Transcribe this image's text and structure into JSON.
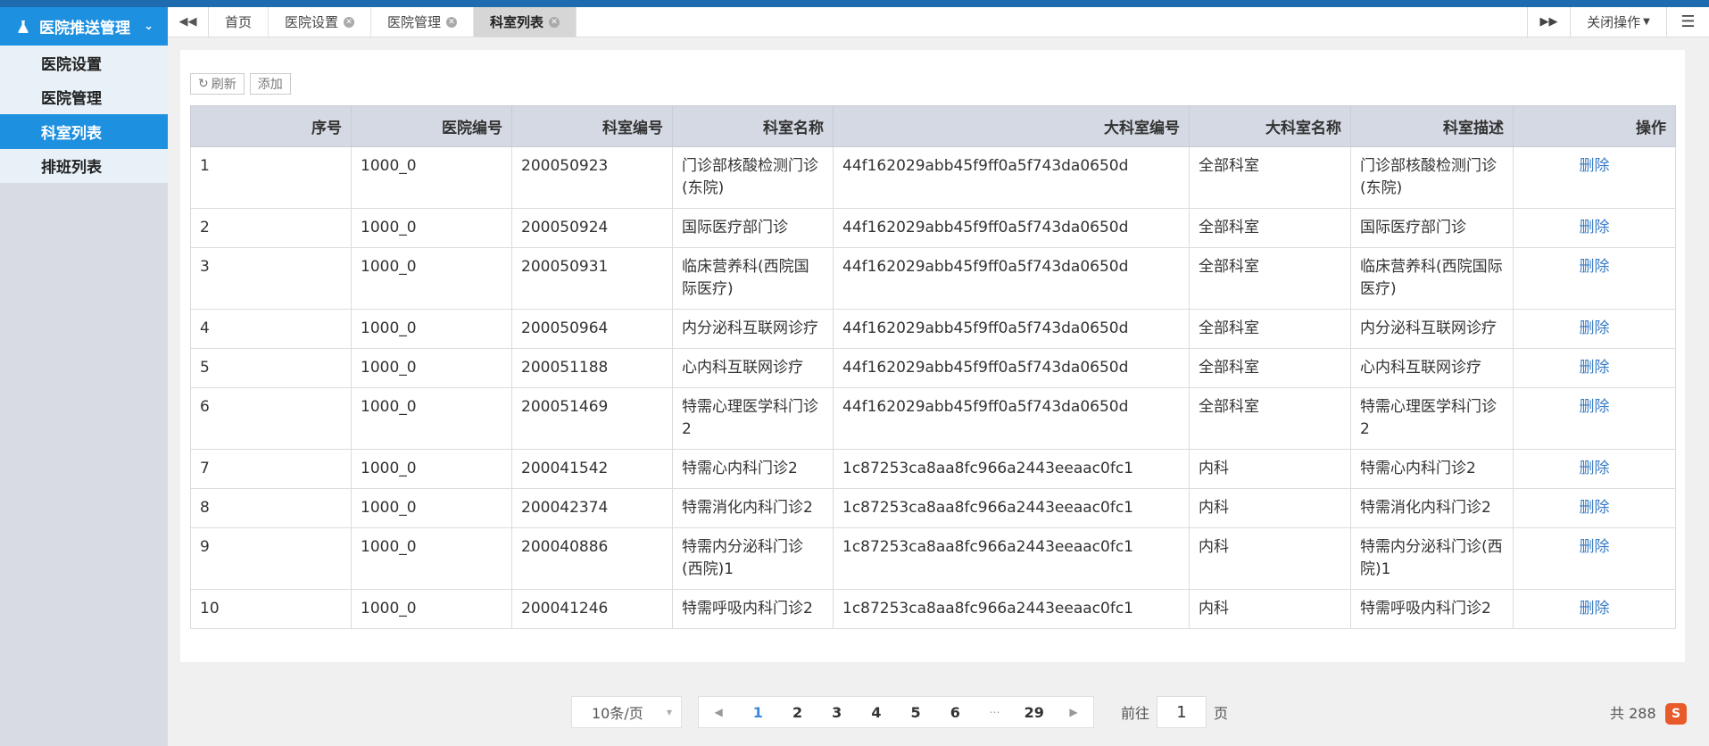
{
  "sidebar": {
    "header": "医院推送管理",
    "items": [
      {
        "label": "医院设置",
        "active": false
      },
      {
        "label": "医院管理",
        "active": false
      },
      {
        "label": "科室列表",
        "active": true
      },
      {
        "label": "排班列表",
        "active": false
      }
    ]
  },
  "tabs": [
    {
      "label": "首页",
      "closable": false,
      "active": false
    },
    {
      "label": "医院设置",
      "closable": true,
      "active": false
    },
    {
      "label": "医院管理",
      "closable": true,
      "active": false
    },
    {
      "label": "科室列表",
      "closable": true,
      "active": true
    }
  ],
  "tabbar_right": {
    "close_ops": "关闭操作"
  },
  "toolbar": {
    "refresh": "刷新",
    "add": "添加"
  },
  "table": {
    "headers": [
      "序号",
      "医院编号",
      "科室编号",
      "科室名称",
      "大科室编号",
      "大科室名称",
      "科室描述",
      "操作"
    ],
    "rows": [
      [
        "1",
        "1000_0",
        "200050923",
        "门诊部核酸检测门诊(东院)",
        "44f162029abb45f9ff0a5f743da0650d",
        "全部科室",
        "门诊部核酸检测门诊(东院)",
        "删除"
      ],
      [
        "2",
        "1000_0",
        "200050924",
        "国际医疗部门诊",
        "44f162029abb45f9ff0a5f743da0650d",
        "全部科室",
        "国际医疗部门诊",
        "删除"
      ],
      [
        "3",
        "1000_0",
        "200050931",
        "临床营养科(西院国际医疗)",
        "44f162029abb45f9ff0a5f743da0650d",
        "全部科室",
        "临床营养科(西院国际医疗)",
        "删除"
      ],
      [
        "4",
        "1000_0",
        "200050964",
        "内分泌科互联网诊疗",
        "44f162029abb45f9ff0a5f743da0650d",
        "全部科室",
        "内分泌科互联网诊疗",
        "删除"
      ],
      [
        "5",
        "1000_0",
        "200051188",
        "心内科互联网诊疗",
        "44f162029abb45f9ff0a5f743da0650d",
        "全部科室",
        "心内科互联网诊疗",
        "删除"
      ],
      [
        "6",
        "1000_0",
        "200051469",
        "特需心理医学科门诊2",
        "44f162029abb45f9ff0a5f743da0650d",
        "全部科室",
        "特需心理医学科门诊2",
        "删除"
      ],
      [
        "7",
        "1000_0",
        "200041542",
        "特需心内科门诊2",
        "1c87253ca8aa8fc966a2443eeaac0fc1",
        "内科",
        "特需心内科门诊2",
        "删除"
      ],
      [
        "8",
        "1000_0",
        "200042374",
        "特需消化内科门诊2",
        "1c87253ca8aa8fc966a2443eeaac0fc1",
        "内科",
        "特需消化内科门诊2",
        "删除"
      ],
      [
        "9",
        "1000_0",
        "200040886",
        "特需内分泌科门诊(西院)1",
        "1c87253ca8aa8fc966a2443eeaac0fc1",
        "内科",
        "特需内分泌科门诊(西院)1",
        "删除"
      ],
      [
        "10",
        "1000_0",
        "200041246",
        "特需呼吸内科门诊2",
        "1c87253ca8aa8fc966a2443eeaac0fc1",
        "内科",
        "特需呼吸内科门诊2",
        "删除"
      ]
    ]
  },
  "pagination": {
    "page_size": "10条/页",
    "pages": [
      "1",
      "2",
      "3",
      "4",
      "5",
      "6",
      "29"
    ],
    "current": "1",
    "goto_prefix": "前往",
    "goto_value": "1",
    "goto_suffix": "页",
    "total": "共 288"
  }
}
